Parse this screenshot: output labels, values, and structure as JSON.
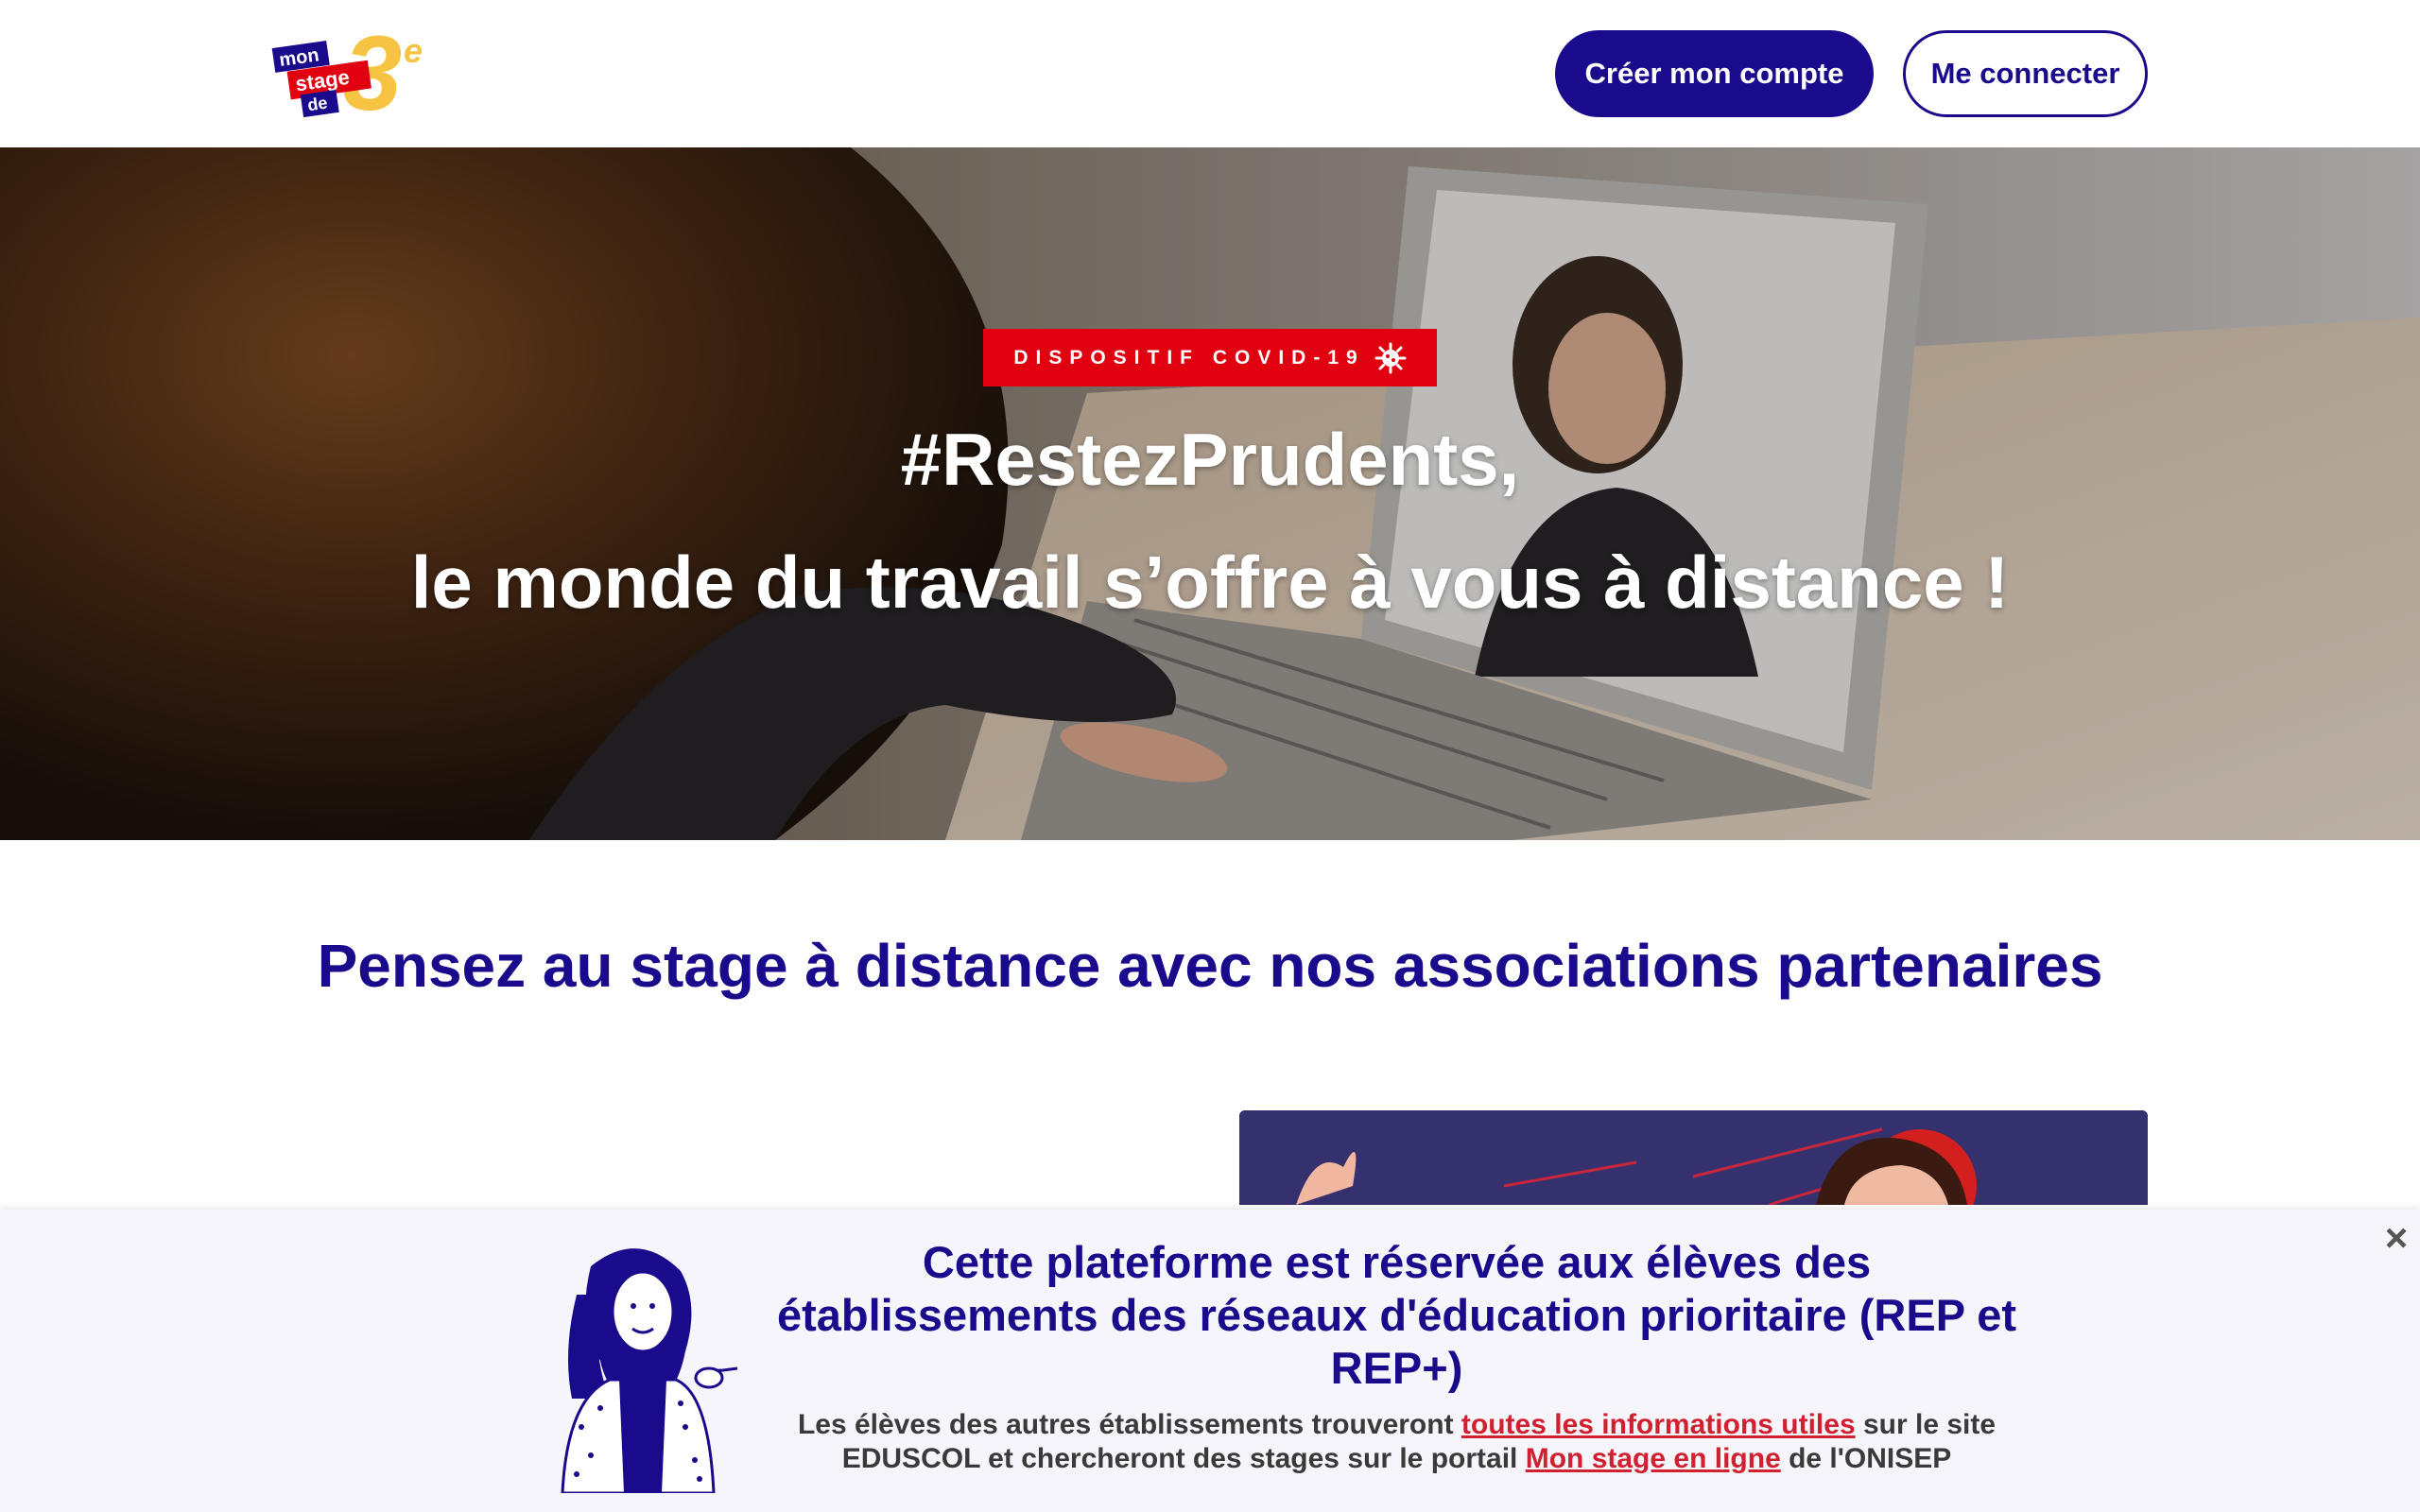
{
  "header": {
    "logo_mon": "mon",
    "logo_stage": "stage",
    "logo_de": "de",
    "logo_number": "3",
    "logo_sup": "e",
    "create_account": "Créer mon compte",
    "login": "Me connecter"
  },
  "hero": {
    "badge": "DISPOSITIF COVID-19",
    "badge_icon": "virus-icon",
    "title_line1": "#RestezPrudents,",
    "title_line2": "le monde du travail s’offre à vous à distance !"
  },
  "section": {
    "title": "Pensez au stage à distance avec nos associations partenaires"
  },
  "notice": {
    "close": "×",
    "title": "Cette plateforme est réservée aux élèves des établissements des réseaux d'éducation prioritaire (REP et REP+)",
    "text_part1": "Les élèves des autres établissements trouveront ",
    "link1": "toutes les informations utiles",
    "text_part2": " sur le site EDUSCOL et chercheront des stages sur le portail ",
    "link2": "Mon stage en ligne",
    "text_part3": " de l'ONISEP"
  },
  "colors": {
    "brand_blue": "#1a0a8c",
    "brand_red": "#e1000f",
    "brand_yellow": "#f6c342",
    "link_red": "#d1202f"
  }
}
